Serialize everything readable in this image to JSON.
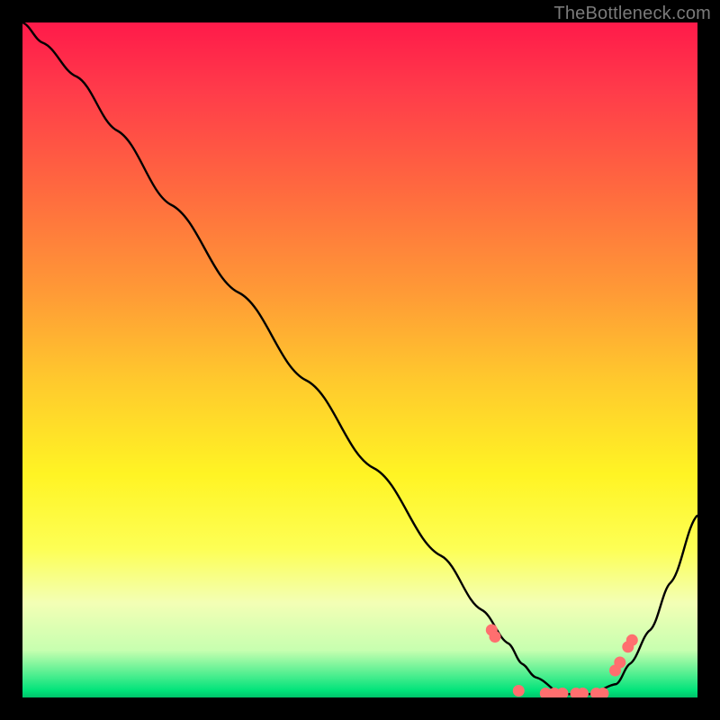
{
  "attribution": "TheBottleneck.com",
  "chart_data": {
    "type": "line",
    "title": "",
    "xlabel": "",
    "ylabel": "",
    "xlim": [
      0,
      100
    ],
    "ylim": [
      0,
      100
    ],
    "grid": false,
    "legend": false,
    "note": "Color gradient background from red (top) through orange/yellow to green (bottom) represents a qualitative severity scale; the black curve is a V-shaped bottleneck curve with its minimum near x≈82. No axis ticks or numeric labels are shown in the image; values below are estimates in percent of plot width/height.",
    "series": [
      {
        "name": "curve",
        "x": [
          0,
          3,
          8,
          14,
          22,
          32,
          42,
          52,
          62,
          68,
          72,
          74,
          76,
          80,
          84,
          88,
          90,
          93,
          96,
          100
        ],
        "y": [
          100,
          97,
          92,
          84,
          73,
          60,
          47,
          34,
          21,
          13,
          8,
          5,
          3,
          0.5,
          0.5,
          2,
          5,
          10,
          17,
          27
        ]
      }
    ],
    "markers": {
      "name": "dots",
      "x": [
        69.5,
        70.0,
        73.5,
        77.5,
        78.8,
        80.0,
        82.0,
        83.0,
        85.0,
        86.0,
        87.8,
        88.5,
        89.7,
        90.3
      ],
      "y": [
        10.0,
        9.0,
        1.0,
        0.6,
        0.6,
        0.6,
        0.6,
        0.6,
        0.6,
        0.6,
        4.0,
        5.2,
        7.5,
        8.5
      ]
    }
  }
}
